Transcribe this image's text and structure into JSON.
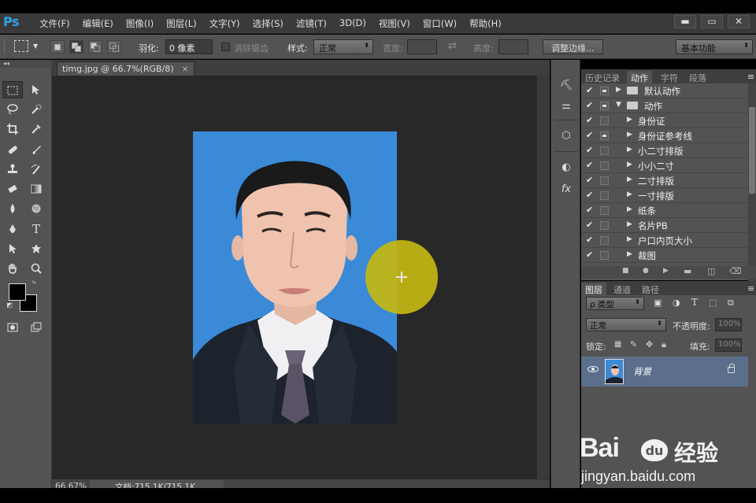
{
  "app": {
    "logo": "Ps"
  },
  "menu": [
    "文件(F)",
    "编辑(E)",
    "图像(I)",
    "图层(L)",
    "文字(Y)",
    "选择(S)",
    "滤镜(T)",
    "3D(D)",
    "视图(V)",
    "窗口(W)",
    "帮助(H)"
  ],
  "window_controls": [
    "▬",
    "▭",
    "✕"
  ],
  "options": {
    "feather_label": "羽化:",
    "feather_value": "0 像素",
    "antialias_label": "消除锯齿",
    "style_label": "样式:",
    "style_value": "正常",
    "width_label": "宽度:",
    "height_label": "高度:",
    "refine_edge": "调整边缘...",
    "workspace": "基本功能"
  },
  "document": {
    "tab_title": "timg.jpg @ 66.7%(RGB/8)",
    "close": "×"
  },
  "status": {
    "zoom": "66.67%",
    "doc_size": "文档:715.1K/715.1K"
  },
  "actions_panel": {
    "tabs": [
      "历史记录",
      "动作",
      "字符",
      "段落"
    ],
    "active_tab": "动作",
    "rows": [
      {
        "label": "默认动作",
        "level": 0,
        "folder": true,
        "expanded": false,
        "box_filled": true
      },
      {
        "label": "动作",
        "level": 0,
        "folder": true,
        "expanded": true,
        "box_filled": true
      },
      {
        "label": "身份证",
        "level": 1,
        "folder": false,
        "expanded": false,
        "box_filled": false
      },
      {
        "label": "身份证参考线",
        "level": 1,
        "folder": false,
        "expanded": false,
        "box_filled": true
      },
      {
        "label": "小二寸排版",
        "level": 1,
        "folder": false,
        "expanded": false,
        "box_filled": false
      },
      {
        "label": "小小二寸",
        "level": 1,
        "folder": false,
        "expanded": false,
        "box_filled": false
      },
      {
        "label": "二寸排版",
        "level": 1,
        "folder": false,
        "expanded": false,
        "box_filled": false
      },
      {
        "label": "一寸排版",
        "level": 1,
        "folder": false,
        "expanded": false,
        "box_filled": false
      },
      {
        "label": "纸条",
        "level": 1,
        "folder": false,
        "expanded": false,
        "box_filled": false
      },
      {
        "label": "名片PB",
        "level": 1,
        "folder": false,
        "expanded": false,
        "box_filled": false
      },
      {
        "label": "户口内页大小",
        "level": 1,
        "folder": false,
        "expanded": false,
        "box_filled": false
      },
      {
        "label": "裁图",
        "level": 1,
        "folder": false,
        "expanded": false,
        "box_filled": false
      }
    ]
  },
  "layers_panel": {
    "tabs": [
      "图层",
      "通道",
      "路径"
    ],
    "active_tab": "图层",
    "filter_label": "ρ 类型",
    "blend_mode": "正常",
    "opacity_label": "不透明度:",
    "opacity_value": "100%",
    "lock_label": "锁定:",
    "fill_label": "填充:",
    "fill_value": "100%",
    "layer_name": "背景"
  },
  "watermark": {
    "brand_left": "Bai",
    "brand_paw": "du",
    "brand_right": "经验",
    "url": "jingyan.baidu.com"
  },
  "colors": {
    "photo_bg": "#3a8ad8",
    "brush_cursor": "#c4b712",
    "selected_layer": "#5b6f8d"
  }
}
